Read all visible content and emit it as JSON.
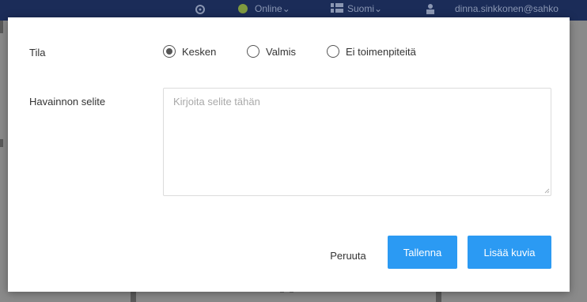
{
  "topbar": {
    "online_label": "Online",
    "language_label": "Suomi",
    "user_email": "dinna.sinkkonen@sahko"
  },
  "form": {
    "status_label": "Tila",
    "status_options": [
      "Kesken",
      "Valmis",
      "Ei toimenpiteitä"
    ],
    "status_selected": "Kesken",
    "description_label": "Havainnon selite",
    "description_placeholder": "Kirjoita selite tähän",
    "description_value": ""
  },
  "actions": {
    "cancel_label": "Peruuta",
    "save_label": "Tallenna",
    "add_images_label": "Lisää kuvia"
  },
  "colors": {
    "primary_button": "#2b9af3",
    "topbar": "#1b2c58"
  }
}
